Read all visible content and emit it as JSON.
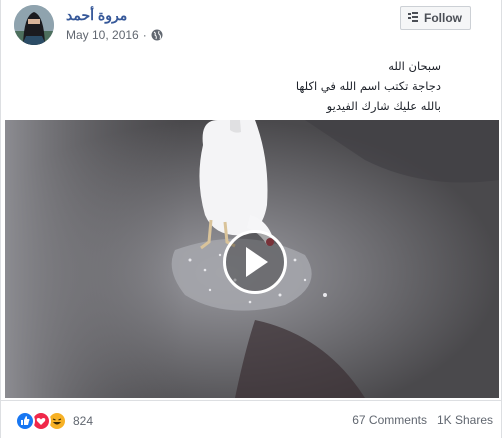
{
  "post": {
    "author": "مروة أحمد",
    "date": "May 10, 2016",
    "privacy_icon": "globe-icon",
    "follow_label": "Follow",
    "text_lines": [
      "سبحان الله",
      "دجاجة تكتب اسم الله في اكلها",
      "بالله عليك شارك الفيديو"
    ]
  },
  "video": {
    "play_icon": "play-icon"
  },
  "engagement": {
    "reaction_icons": [
      "like-icon",
      "love-icon",
      "haha-icon"
    ],
    "reaction_count": "824",
    "comments": "67 Comments",
    "shares": "1K Shares"
  },
  "colors": {
    "link_blue": "#365899",
    "like_blue": "#1877f2",
    "love_red": "#f0284a",
    "haha_yellow": "#f7b125"
  }
}
